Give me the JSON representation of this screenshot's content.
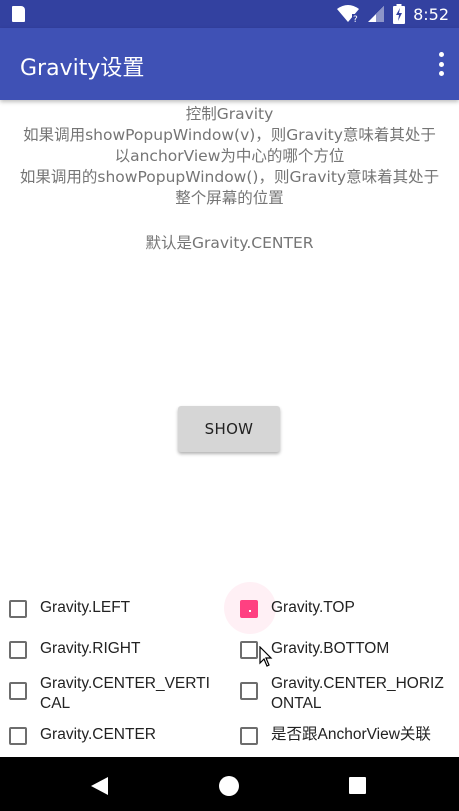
{
  "status_bar": {
    "time": "8:52",
    "icons": [
      "sd-card-icon",
      "wifi-icon",
      "signal-icon",
      "battery-charging-icon"
    ]
  },
  "app_bar": {
    "title": "Gravity设置",
    "menu_icon": "more-vert-icon"
  },
  "description": {
    "lines": [
      "控制Gravity",
      "如果调用showPopupWindow(v)，则Gravity意味着其处于",
      "以anchorView为中心的哪个方位",
      "如果调用的showPopupWindow()，则Gravity意味着其处于",
      "整个屏幕的位置"
    ],
    "default_text": "默认是Gravity.CENTER"
  },
  "show_button": {
    "label": "SHOW"
  },
  "checkboxes": [
    {
      "label": "Gravity.LEFT",
      "checked": false
    },
    {
      "label": "Gravity.TOP",
      "checked": true
    },
    {
      "label": "Gravity.RIGHT",
      "checked": false
    },
    {
      "label": "Gravity.BOTTOM",
      "checked": false
    },
    {
      "label_line1": "Gravity.CENTER_VERTI",
      "label_line2": "CAL",
      "checked": false
    },
    {
      "label_line1": "Gravity.CENTER_HORIZ",
      "label_line2": "ONTAL",
      "checked": false
    },
    {
      "label": "Gravity.CENTER",
      "checked": false
    },
    {
      "label": "是否跟AnchorView关联",
      "checked": false
    }
  ],
  "colors": {
    "status_bar": "#3341a0",
    "app_bar": "#3f51b5",
    "accent": "#ff4081",
    "text_secondary": "#757575"
  },
  "nav_bar": {
    "icons": [
      "back-icon",
      "home-icon",
      "recents-icon"
    ]
  }
}
